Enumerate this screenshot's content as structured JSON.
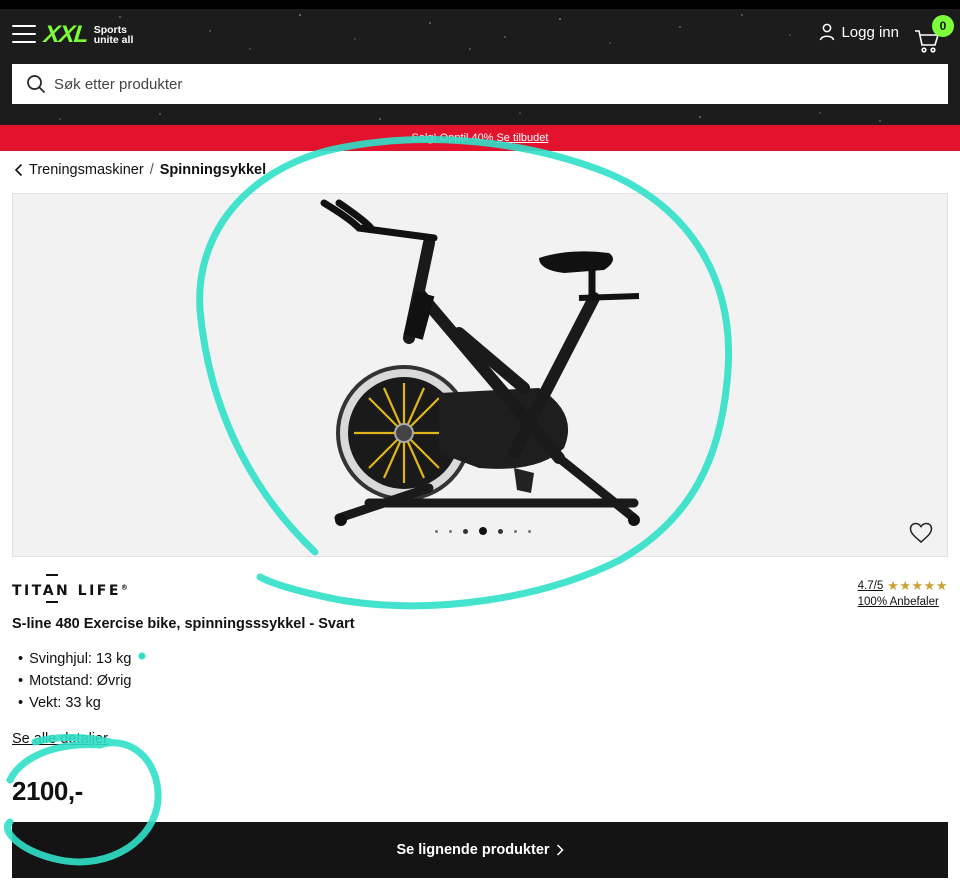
{
  "header": {
    "logo": {
      "brand": "XXL",
      "tagline_line1": "Sports",
      "tagline_line2": "unite all"
    },
    "login_label": "Logg inn",
    "cart_count": "0",
    "search_placeholder": "Søk etter produkter",
    "colors": {
      "background": "#1c1c1c",
      "accent": "#7cff3a"
    }
  },
  "promo": {
    "text": "Salg! Opptil 40%",
    "link": "Se tilbudet",
    "color": "#e3122d"
  },
  "breadcrumb": {
    "parent": "Treningsmaskiner",
    "separator": "/",
    "current": "Spinningsykkel"
  },
  "gallery": {
    "slide_count": 7,
    "active_slide": 4,
    "favorite_icon": "heart-icon"
  },
  "product": {
    "brand": "TITAN LIFE",
    "brand_mark": "®",
    "rating": "4.7/5",
    "rating_stars": "★★★★★",
    "recommend": "100% Anbefaler",
    "title": "S-line 480 Exercise bike, spinningsssykkel - Svart",
    "specs": [
      "Svinghjul: 13 kg",
      "Motstand: Øvrig",
      "Vekt: 33 kg"
    ],
    "see_all_details": "Se alle detaljer",
    "price": "2100,-",
    "cta_label": "Se lignende produkter"
  }
}
